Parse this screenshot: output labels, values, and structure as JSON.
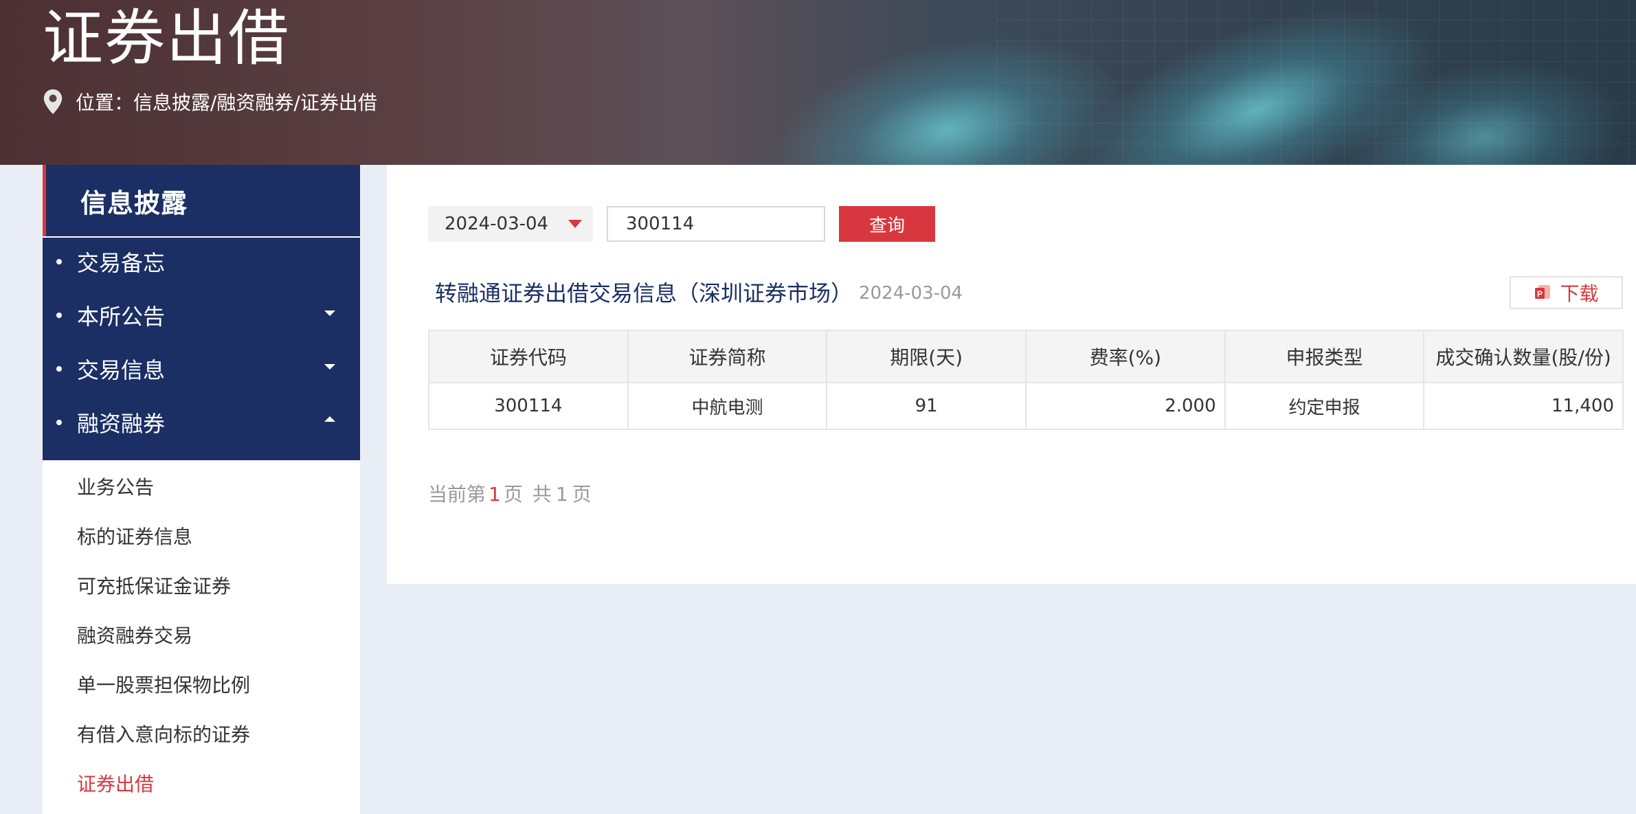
{
  "header": {
    "title": "证券出借",
    "breadcrumb": "位置：信息披露/融资融券/证券出借"
  },
  "sidebar": {
    "heading": "信息披露",
    "nav": [
      {
        "label": "交易备忘",
        "caret": "none"
      },
      {
        "label": "本所公告",
        "caret": "down"
      },
      {
        "label": "交易信息",
        "caret": "down"
      },
      {
        "label": "融资融券",
        "caret": "up"
      }
    ],
    "sub_items": [
      {
        "label": "业务公告"
      },
      {
        "label": "标的证券信息"
      },
      {
        "label": "可充抵保证金证券"
      },
      {
        "label": "融资融券交易"
      },
      {
        "label": "单一股票担保物比例"
      },
      {
        "label": "有借入意向标的证券"
      },
      {
        "label": "证券出借",
        "active": true
      }
    ]
  },
  "query": {
    "date_value": "2024-03-04",
    "code_value": "300114",
    "button_label": "查询"
  },
  "section": {
    "title": "转融通证券出借交易信息（深圳证券市场）",
    "date": "2024-03-04",
    "download_label": "下载"
  },
  "table": {
    "headers": [
      "证券代码",
      "证券简称",
      "期限(天)",
      "费率(%)",
      "申报类型",
      "成交确认数量(股/份)"
    ],
    "rows": [
      [
        "300114",
        "中航电测",
        "91",
        "2.000",
        "约定申报",
        "11,400"
      ]
    ]
  },
  "pager": {
    "prefix": "当前第",
    "current": "1",
    "page_word": "页",
    "total_prefix": "共",
    "total": "1",
    "total_suffix": "页"
  },
  "colors": {
    "brand_navy": "#1b2f65",
    "accent_red": "#d9373f",
    "page_bg": "#e9edf5"
  }
}
